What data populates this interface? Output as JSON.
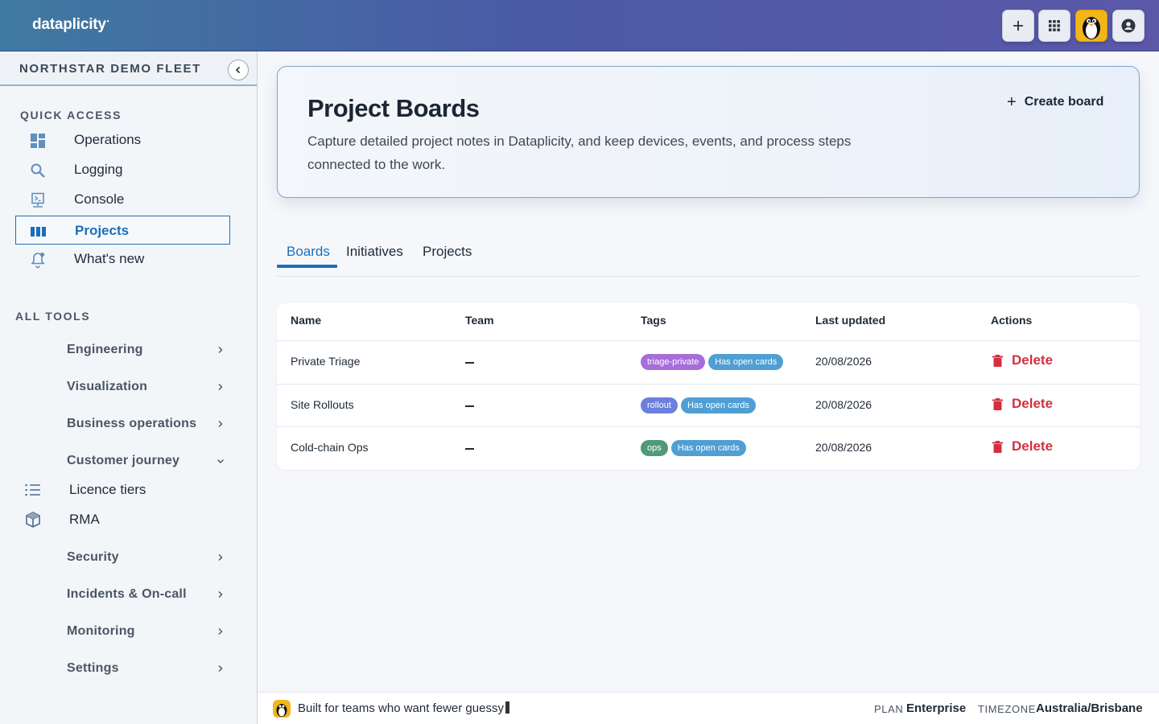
{
  "app": {
    "logo": "dataplicity",
    "logo_mark": "•"
  },
  "topbar": {
    "add_label": "+"
  },
  "sidebar": {
    "fleet_name": "NORTHSTAR DEMO FLEET",
    "quick_access_heading": "QUICK ACCESS",
    "quick_access": [
      {
        "label": "Operations",
        "icon": "dashboard-icon"
      },
      {
        "label": "Logging",
        "icon": "search-icon"
      },
      {
        "label": "Console",
        "icon": "console-icon"
      },
      {
        "label": "Projects",
        "icon": "board-columns-icon",
        "active": true
      },
      {
        "label": "What's new",
        "icon": "bell-icon"
      }
    ],
    "all_tools_heading": "ALL TOOLS",
    "tools": [
      {
        "label": "Engineering"
      },
      {
        "label": "Visualization"
      },
      {
        "label": "Business operations"
      },
      {
        "label": "Customer journey",
        "expanded": true
      },
      {
        "label": "Security"
      },
      {
        "label": "Incidents & On-call"
      },
      {
        "label": "Monitoring"
      },
      {
        "label": "Settings"
      }
    ],
    "customer_journey_children": [
      {
        "label": "Licence tiers",
        "icon": "list-icon"
      },
      {
        "label": "RMA",
        "icon": "box-icon"
      }
    ]
  },
  "hero": {
    "title": "Project Boards",
    "description": "Capture detailed project notes in Dataplicity, and keep devices, events, and process steps connected to the work.",
    "create_plus": "+",
    "create_label": "Create board"
  },
  "tabs": [
    {
      "label": "Boards",
      "active": true
    },
    {
      "label": "Initiatives"
    },
    {
      "label": "Projects"
    }
  ],
  "table": {
    "columns": [
      "Name",
      "Team",
      "Tags",
      "Last updated",
      "Actions"
    ],
    "rows": [
      {
        "name": "Private Triage",
        "team": "—",
        "tags": [
          {
            "label": "triage-private",
            "color": "#a76ddb"
          },
          {
            "label": "Has open cards",
            "color": "#4f9fd4"
          }
        ],
        "updated": "20/08/2026",
        "action": "Delete"
      },
      {
        "name": "Site Rollouts",
        "team": "—",
        "tags": [
          {
            "label": "rollout",
            "color": "#6b7fdc"
          },
          {
            "label": "Has open cards",
            "color": "#4f9fd4"
          }
        ],
        "updated": "20/08/2026",
        "action": "Delete"
      },
      {
        "name": "Cold-chain Ops",
        "team": "—",
        "tags": [
          {
            "label": "ops",
            "color": "#4f9a78"
          },
          {
            "label": "Has open cards",
            "color": "#4f9fd4"
          }
        ],
        "updated": "20/08/2026",
        "action": "Delete"
      }
    ]
  },
  "footer": {
    "tagline": "Built for teams who want fewer guessy",
    "plan_key": "PLAN",
    "plan_value": "Enterprise",
    "timezone_key": "TIMEZONE",
    "timezone_value": "Australia/Brisbane"
  },
  "colors": {
    "accent": "#1b6fb8",
    "danger": "#d32f3f",
    "topbar_start": "#3f7aa0",
    "topbar_end": "#5b58a8"
  }
}
